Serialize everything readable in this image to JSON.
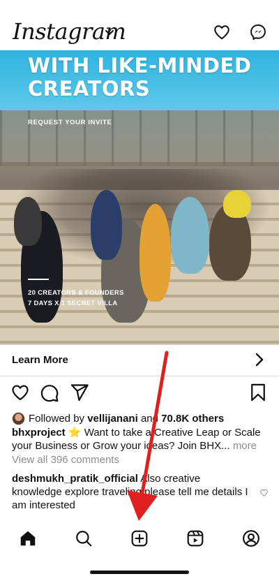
{
  "app": {
    "logo_text": "Instagram"
  },
  "header": {
    "icons": [
      "chevron-down-icon",
      "heart-icon",
      "messenger-icon"
    ]
  },
  "post": {
    "image": {
      "headline_line1": "WITH LIKE-MINDED",
      "headline_line2": "CREATORS",
      "invite_text": "REQUEST YOUR INVITE",
      "caption_line1": "20 CREATORS & FOUNDERS",
      "caption_line2": "7 DAYS X 1 SECRET VILLA"
    },
    "cta": {
      "label": "Learn More"
    },
    "followed": {
      "prefix": "Followed by",
      "user": "vellijanani",
      "joiner": "and",
      "others": "70.8K others"
    },
    "caption": {
      "username": "bhxproject",
      "emoji": "⭐",
      "text": "Want to take a Creative Leap or Scale your Business or Grow your ideas? Join BHX...",
      "more": "more"
    },
    "comments_link": "View all 396 comments",
    "top_comment": {
      "username": "deshmukh_pratik_official",
      "text": "Also creative knowledge explore traveling please tell me details I am interested"
    }
  },
  "bottom_nav": {
    "items": [
      "home-icon",
      "search-icon",
      "create-icon",
      "reels-icon",
      "profile-icon"
    ],
    "active": "home-icon"
  },
  "annotation": {
    "arrow_color": "#e0201f"
  }
}
